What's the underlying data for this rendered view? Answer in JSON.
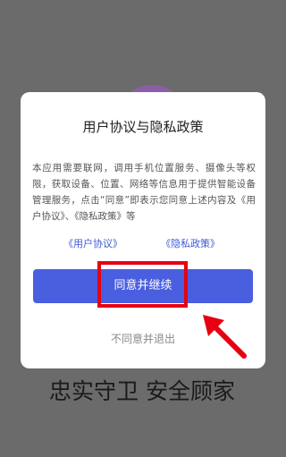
{
  "dialog": {
    "title": "用户协议与隐私政策",
    "body": "本应用需要联网，调用手机位置服务、摄像头等权限，获取设备、位置、网络等信息用于提供智能设备管理服务，点击“同意”即表示您同意上述内容及《用户协议》、《隐私政策》等",
    "link_user_agreement": "《用户协议》",
    "link_privacy_policy": "《隐私政策》",
    "agree_label": "同意并继续",
    "decline_label": "不同意并退出"
  },
  "background": {
    "slogan": "忠实守卫 安全顾家"
  },
  "colors": {
    "accent": "#4a5ee0",
    "highlight": "#e60012",
    "overlay": "#6b6b6b"
  },
  "icons": [
    "play-icon",
    "red-arrow-annotation"
  ]
}
